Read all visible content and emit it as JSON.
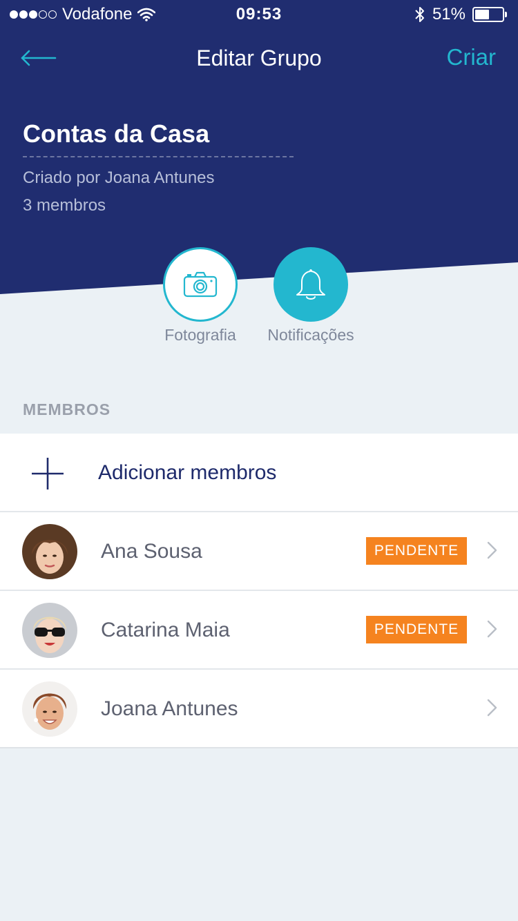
{
  "colors": {
    "header_bg": "#202d70",
    "accent": "#23b7cf",
    "badge": "#f5831f",
    "page_bg": "#ebf1f5"
  },
  "status_bar": {
    "carrier": "Vodafone",
    "signal_bars_filled": 3,
    "signal_bars_total": 5,
    "time": "09:53",
    "battery": "51%",
    "battery_level": 0.51,
    "icons": [
      "wifi-icon",
      "bluetooth-icon",
      "battery-icon"
    ]
  },
  "nav": {
    "back_icon": "arrow-left-icon",
    "title": "Editar Grupo",
    "action": "Criar"
  },
  "group": {
    "name": "Contas da Casa",
    "created_by": "Criado por Joana Antunes",
    "member_count": "3 membros"
  },
  "actions": [
    {
      "label": "Fotografia",
      "icon": "camera-icon"
    },
    {
      "label": "Notificações",
      "icon": "bell-icon"
    }
  ],
  "members_section": {
    "title": "MEMBROS",
    "add_label": "Adicionar membros",
    "add_icon": "plus-icon",
    "members": [
      {
        "name": "Ana Sousa",
        "status": "PENDENTE"
      },
      {
        "name": "Catarina Maia",
        "status": "PENDENTE"
      },
      {
        "name": "Joana Antunes",
        "status": ""
      }
    ]
  }
}
